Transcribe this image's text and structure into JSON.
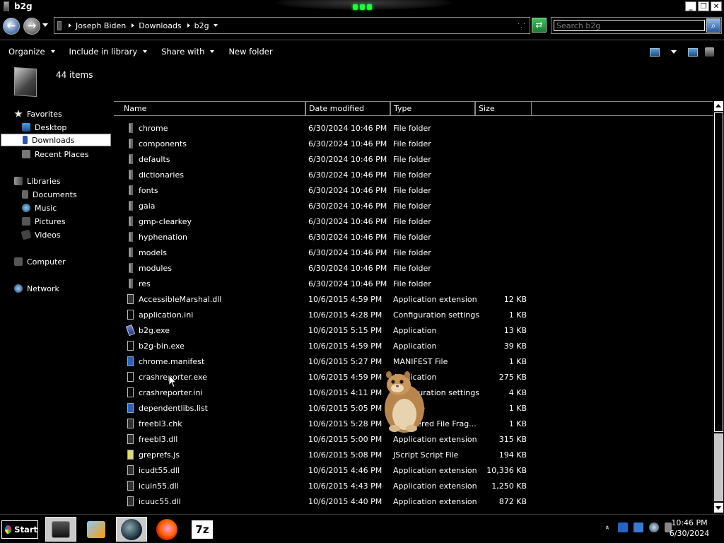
{
  "window": {
    "title": "b2g",
    "buttons": [
      "_",
      "❐",
      "✕"
    ]
  },
  "address": {
    "crumbs": [
      "Joseph Biden",
      "Downloads",
      "b2g"
    ],
    "search_placeholder": "Search b2g"
  },
  "toolbar": {
    "organize": "Organize",
    "include": "Include in library",
    "share": "Share with",
    "newfolder": "New folder"
  },
  "details": {
    "count": "44 items"
  },
  "nav": {
    "favorites": "Favorites",
    "desktop": "Desktop",
    "downloads": "Downloads",
    "recent": "Recent Places",
    "libraries": "Libraries",
    "documents": "Documents",
    "music": "Music",
    "pictures": "Pictures",
    "videos": "Videos",
    "computer": "Computer",
    "network": "Network"
  },
  "columns": {
    "name": "Name",
    "date": "Date modified",
    "type": "Type",
    "size": "Size"
  },
  "files": [
    {
      "name": "chrome",
      "date": "6/30/2024 10:46 PM",
      "type": "File folder",
      "size": "",
      "icon": "folder"
    },
    {
      "name": "components",
      "date": "6/30/2024 10:46 PM",
      "type": "File folder",
      "size": "",
      "icon": "folder"
    },
    {
      "name": "defaults",
      "date": "6/30/2024 10:46 PM",
      "type": "File folder",
      "size": "",
      "icon": "folder"
    },
    {
      "name": "dictionaries",
      "date": "6/30/2024 10:46 PM",
      "type": "File folder",
      "size": "",
      "icon": "folder"
    },
    {
      "name": "fonts",
      "date": "6/30/2024 10:46 PM",
      "type": "File folder",
      "size": "",
      "icon": "folder"
    },
    {
      "name": "gaia",
      "date": "6/30/2024 10:46 PM",
      "type": "File folder",
      "size": "",
      "icon": "folder"
    },
    {
      "name": "gmp-clearkey",
      "date": "6/30/2024 10:46 PM",
      "type": "File folder",
      "size": "",
      "icon": "folder"
    },
    {
      "name": "hyphenation",
      "date": "6/30/2024 10:46 PM",
      "type": "File folder",
      "size": "",
      "icon": "folder"
    },
    {
      "name": "models",
      "date": "6/30/2024 10:46 PM",
      "type": "File folder",
      "size": "",
      "icon": "folder"
    },
    {
      "name": "modules",
      "date": "6/30/2024 10:46 PM",
      "type": "File folder",
      "size": "",
      "icon": "folder"
    },
    {
      "name": "res",
      "date": "6/30/2024 10:46 PM",
      "type": "File folder",
      "size": "",
      "icon": "folder"
    },
    {
      "name": "AccessibleMarshal.dll",
      "date": "10/6/2015 4:59 PM",
      "type": "Application extension",
      "size": "12 KB",
      "icon": "dll"
    },
    {
      "name": "application.ini",
      "date": "10/6/2015 4:28 PM",
      "type": "Configuration settings",
      "size": "1 KB",
      "icon": "doc"
    },
    {
      "name": "b2g.exe",
      "date": "10/6/2015 5:15 PM",
      "type": "Application",
      "size": "13 KB",
      "icon": "exe"
    },
    {
      "name": "b2g-bin.exe",
      "date": "10/6/2015 4:59 PM",
      "type": "Application",
      "size": "39 KB",
      "icon": "doc"
    },
    {
      "name": "chrome.manifest",
      "date": "10/6/2015 5:27 PM",
      "type": "MANIFEST File",
      "size": "1 KB",
      "icon": "blue"
    },
    {
      "name": "crashreporter.exe",
      "date": "10/6/2015 4:59 PM",
      "type": "Application",
      "size": "275 KB",
      "icon": "doc"
    },
    {
      "name": "crashreporter.ini",
      "date": "10/6/2015 4:11 PM",
      "type": "Configuration settings",
      "size": "4 KB",
      "icon": "doc"
    },
    {
      "name": "dependentlibs.list",
      "date": "10/6/2015 5:05 PM",
      "type": "LIST File",
      "size": "1 KB",
      "icon": "blue"
    },
    {
      "name": "freebl3.chk",
      "date": "10/6/2015 5:28 PM",
      "type": "Recovered File Frag...",
      "size": "1 KB",
      "icon": "dll"
    },
    {
      "name": "freebl3.dll",
      "date": "10/6/2015 5:00 PM",
      "type": "Application extension",
      "size": "315 KB",
      "icon": "dll"
    },
    {
      "name": "greprefs.js",
      "date": "10/6/2015 5:08 PM",
      "type": "JScript Script File",
      "size": "194 KB",
      "icon": "js"
    },
    {
      "name": "icudt55.dll",
      "date": "10/6/2015 4:46 PM",
      "type": "Application extension",
      "size": "10,336 KB",
      "icon": "dll"
    },
    {
      "name": "icuin55.dll",
      "date": "10/6/2015 4:43 PM",
      "type": "Application extension",
      "size": "1,250 KB",
      "icon": "dll"
    },
    {
      "name": "icuuc55.dll",
      "date": "10/6/2015 4:40 PM",
      "type": "Application extension",
      "size": "872 KB",
      "icon": "dll"
    }
  ],
  "taskbar": {
    "start": "Start",
    "time": "10:46 PM",
    "date": "6/30/2024",
    "sevenzip": "7z",
    "tray_chevron": "»"
  },
  "colors": {
    "background": "#000000",
    "text": "#ffffff",
    "selection": "#ffffff",
    "accent": "#1aff3a"
  }
}
